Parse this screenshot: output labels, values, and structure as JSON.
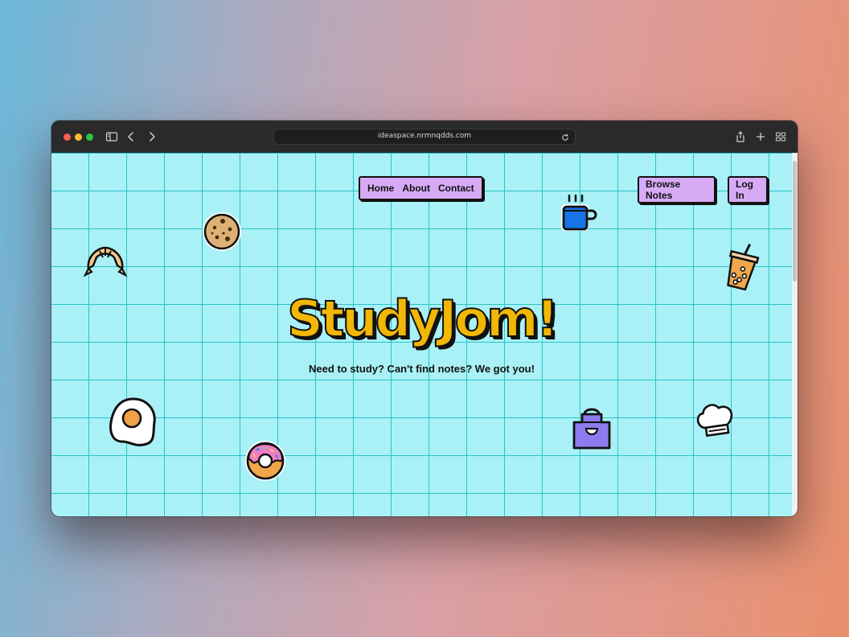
{
  "browser": {
    "url": "ideaspace.nrmnqdds.com",
    "icons": [
      "sidebar-icon",
      "back-icon",
      "forward-icon",
      "reload-icon",
      "share-icon",
      "new-tab-icon",
      "tab-overview-icon"
    ]
  },
  "nav": {
    "links": [
      "Home",
      "About",
      "Contact"
    ]
  },
  "actions": {
    "browse_label": "Browse Notes",
    "login_label": "Log In"
  },
  "hero": {
    "title": "StudyJom!",
    "subtitle": "Need to study? Can't find notes? We got you!"
  },
  "stickers": [
    "croissant-icon",
    "cookie-icon",
    "coffee-cup-icon",
    "boba-tea-icon",
    "fried-egg-icon",
    "donut-icon",
    "apron-icon",
    "chef-hat-icon"
  ],
  "colors": {
    "background": "#a9f1f7",
    "grid": "#27c4c8",
    "button": "#d7aaf6",
    "title": "#f2b705"
  }
}
